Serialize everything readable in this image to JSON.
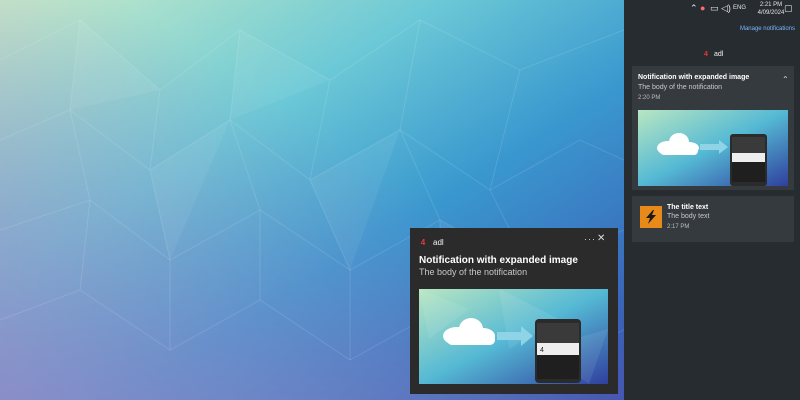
{
  "toast": {
    "app_name": "adl",
    "app_icon": "adl-app-icon",
    "title": "Notification with expanded image",
    "body": "The body of the notification",
    "more_icon": "more-icon",
    "close_icon": "close-icon"
  },
  "tray": {
    "icons": [
      "chevron-up-icon",
      "security-icon",
      "network-icon",
      "volume-icon"
    ],
    "language": "ENG",
    "time": "2:21 PM",
    "date": "4/09/2024",
    "notification_center_icon": "notification-center-icon"
  },
  "action_center": {
    "manage_link": "Manage notifications",
    "group_app_name": "adl",
    "notifications": [
      {
        "title": "Notification with expanded image",
        "body": "The body of the notification",
        "time": "2:20 PM",
        "icon": "chevron-up-icon"
      },
      {
        "title": "The title text",
        "body": "The body text",
        "time": "2:17 PM",
        "icon": "lightning-app-icon"
      }
    ]
  },
  "colors": {
    "panel_bg": "#272c30",
    "card_bg": "#353a3e",
    "toast_bg": "#2b2b2b",
    "link": "#7ab6ff",
    "app_accent": "#e23a3a",
    "orange_icon": "#e88a1a"
  }
}
